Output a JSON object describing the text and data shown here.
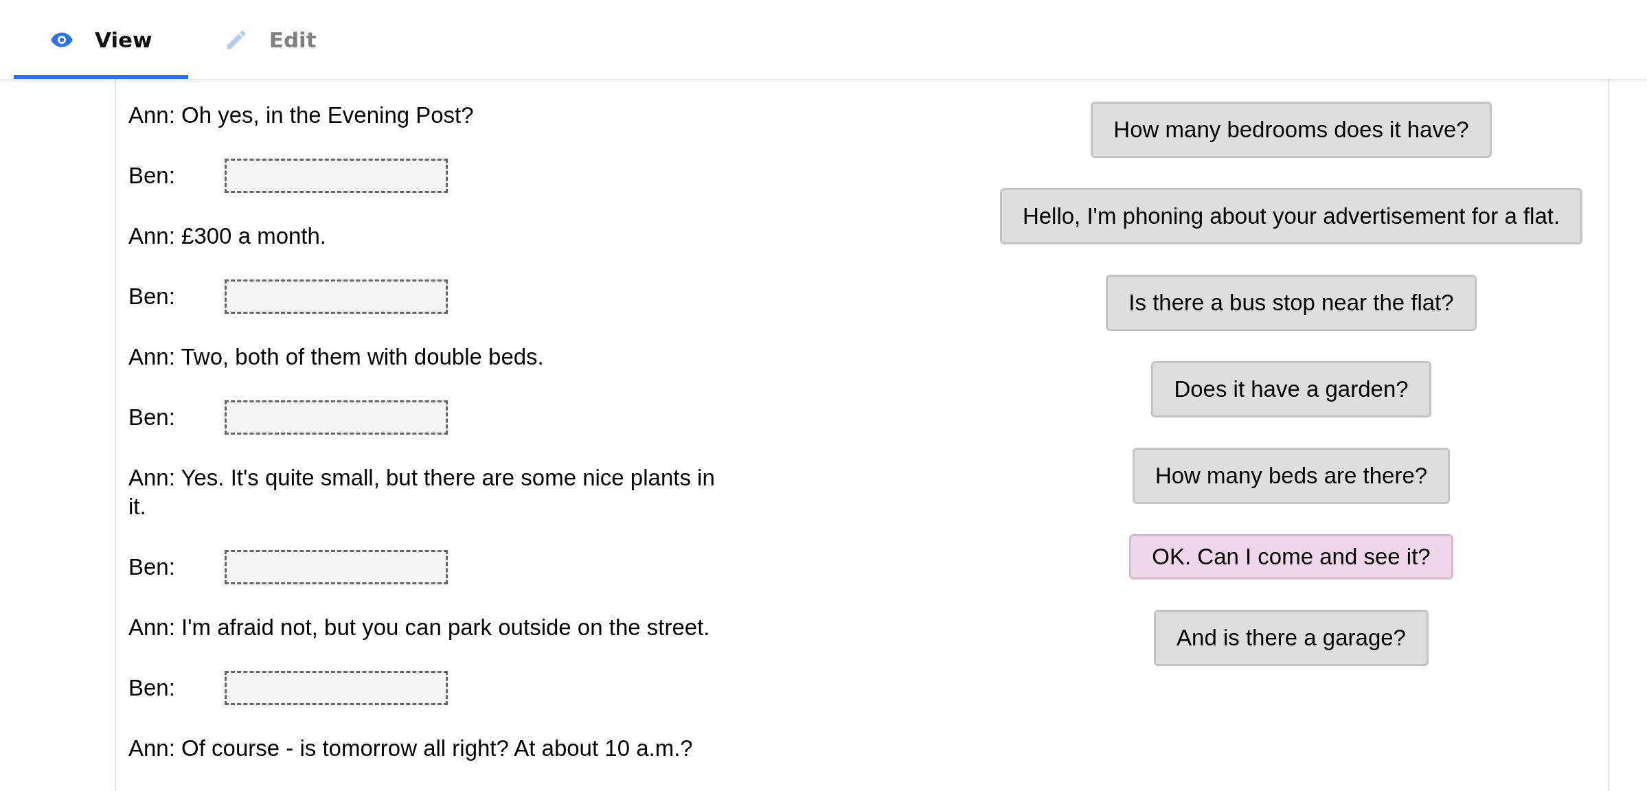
{
  "tabs": [
    {
      "label": "View",
      "kind": "eye",
      "selected": true
    },
    {
      "label": "Edit",
      "kind": "pencil",
      "selected": false
    }
  ],
  "dialogue": [
    {
      "kind": "line",
      "text": "Ann: Oh yes, in the Evening Post?"
    },
    {
      "kind": "gap",
      "speaker": "Ben:"
    },
    {
      "kind": "line",
      "text": "Ann: £300 a month."
    },
    {
      "kind": "gap",
      "speaker": "Ben:"
    },
    {
      "kind": "line",
      "text": "Ann: Two, both of them with double beds."
    },
    {
      "kind": "gap",
      "speaker": "Ben:"
    },
    {
      "kind": "line",
      "text": "Ann: Yes. It's quite small, but there are some nice plants in it."
    },
    {
      "kind": "gap",
      "speaker": "Ben:"
    },
    {
      "kind": "line",
      "text": "Ann: I'm afraid not, but you can park outside on the street."
    },
    {
      "kind": "gap",
      "speaker": "Ben:"
    },
    {
      "kind": "line",
      "text": "Ann: Of course - is tomorrow all right? At about 10 a.m.?"
    }
  ],
  "options": [
    {
      "text": "How many bedrooms does it have?",
      "selected": false
    },
    {
      "text": "Hello, I'm phoning about your advertisement for a flat.",
      "selected": false
    },
    {
      "text": "Is there a bus stop near the flat?",
      "selected": false
    },
    {
      "text": "Does it have a garden?",
      "selected": false
    },
    {
      "text": "How many beds are there?",
      "selected": false
    },
    {
      "text": "OK. Can I come and see it?",
      "selected": true
    },
    {
      "text": "And is there a garage?",
      "selected": false
    }
  ]
}
